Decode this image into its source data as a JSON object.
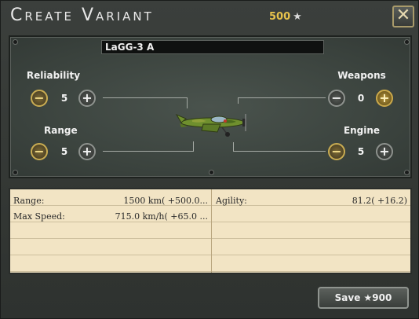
{
  "window": {
    "title": "Create Variant",
    "cost": "500",
    "cost_star": "★",
    "close_glyph": "✕"
  },
  "variant_name": "LaGG-3 A",
  "modules": [
    {
      "label": "Reliability",
      "value": "5",
      "minus": "−",
      "plus": "+"
    },
    {
      "label": "Range",
      "value": "5",
      "minus": "−",
      "plus": "+"
    },
    {
      "label": "Weapons",
      "value": "0",
      "minus": "−",
      "plus": "+"
    },
    {
      "label": "Engine",
      "value": "5",
      "minus": "−",
      "plus": "+"
    }
  ],
  "stats": {
    "left": [
      {
        "label": "Range:",
        "value": "1500 km( +500.0..."
      },
      {
        "label": "Max Speed:",
        "value": "715.0 km/h( +65.0 ..."
      }
    ],
    "right": [
      {
        "label": "Agility:",
        "value": "81.2( +16.2)"
      }
    ]
  },
  "save_button": {
    "label": "Save ★900"
  },
  "colors": {
    "accent_gold": "#e7c24c",
    "panel_green": "#3a423d",
    "stats_bg": "#f2e4c4"
  }
}
